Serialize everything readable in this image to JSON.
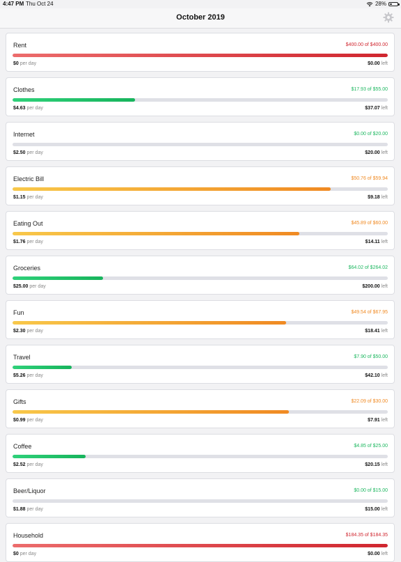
{
  "status_bar": {
    "time": "4:47 PM",
    "date": "Thu Oct 24",
    "battery": "28%",
    "battery_level": 0.28
  },
  "nav": {
    "title": "October 2019",
    "settings_icon": "gear-icon"
  },
  "per_day_suffix": "per day",
  "left_suffix": "left",
  "colors": {
    "over": "#d0262f",
    "under": "#1cb75f",
    "warning": "#f08a23",
    "track": "#dfe0e6"
  },
  "budgets": [
    {
      "name": "Rent",
      "amount": "$400.00 of $400.00",
      "status": "red",
      "progress": 1.0,
      "per_day": "$0",
      "left": "$0.00"
    },
    {
      "name": "Clothes",
      "amount": "$17.93 of $55.00",
      "status": "green",
      "progress": 0.326,
      "per_day": "$4.63",
      "left": "$37.07"
    },
    {
      "name": "Internet",
      "amount": "$0.00 of $20.00",
      "status": "green",
      "progress": 0.0,
      "per_day": "$2.50",
      "left": "$20.00"
    },
    {
      "name": "Electric Bill",
      "amount": "$50.76 of $59.94",
      "status": "orange",
      "progress": 0.847,
      "per_day": "$1.15",
      "left": "$9.18"
    },
    {
      "name": "Eating Out",
      "amount": "$45.89 of $60.00",
      "status": "orange",
      "progress": 0.765,
      "per_day": "$1.76",
      "left": "$14.11"
    },
    {
      "name": "Groceries",
      "amount": "$64.02 of $264.02",
      "status": "green",
      "progress": 0.242,
      "per_day": "$25.00",
      "left": "$200.00"
    },
    {
      "name": "Fun",
      "amount": "$49.54 of $67.95",
      "status": "orange",
      "progress": 0.729,
      "per_day": "$2.30",
      "left": "$18.41"
    },
    {
      "name": "Travel",
      "amount": "$7.90 of $50.00",
      "status": "green",
      "progress": 0.158,
      "per_day": "$5.26",
      "left": "$42.10"
    },
    {
      "name": "Gifts",
      "amount": "$22.09 of $30.00",
      "status": "orange",
      "progress": 0.736,
      "per_day": "$0.99",
      "left": "$7.91"
    },
    {
      "name": "Coffee",
      "amount": "$4.85 of $25.00",
      "status": "green",
      "progress": 0.194,
      "per_day": "$2.52",
      "left": "$20.15"
    },
    {
      "name": "Beer/Liquor",
      "amount": "$0.00 of $15.00",
      "status": "green",
      "progress": 0.0,
      "per_day": "$1.88",
      "left": "$15.00"
    },
    {
      "name": "Household",
      "amount": "$184.35 of $184.35",
      "status": "red",
      "progress": 1.0,
      "per_day": "$0",
      "left": "$0.00"
    }
  ]
}
